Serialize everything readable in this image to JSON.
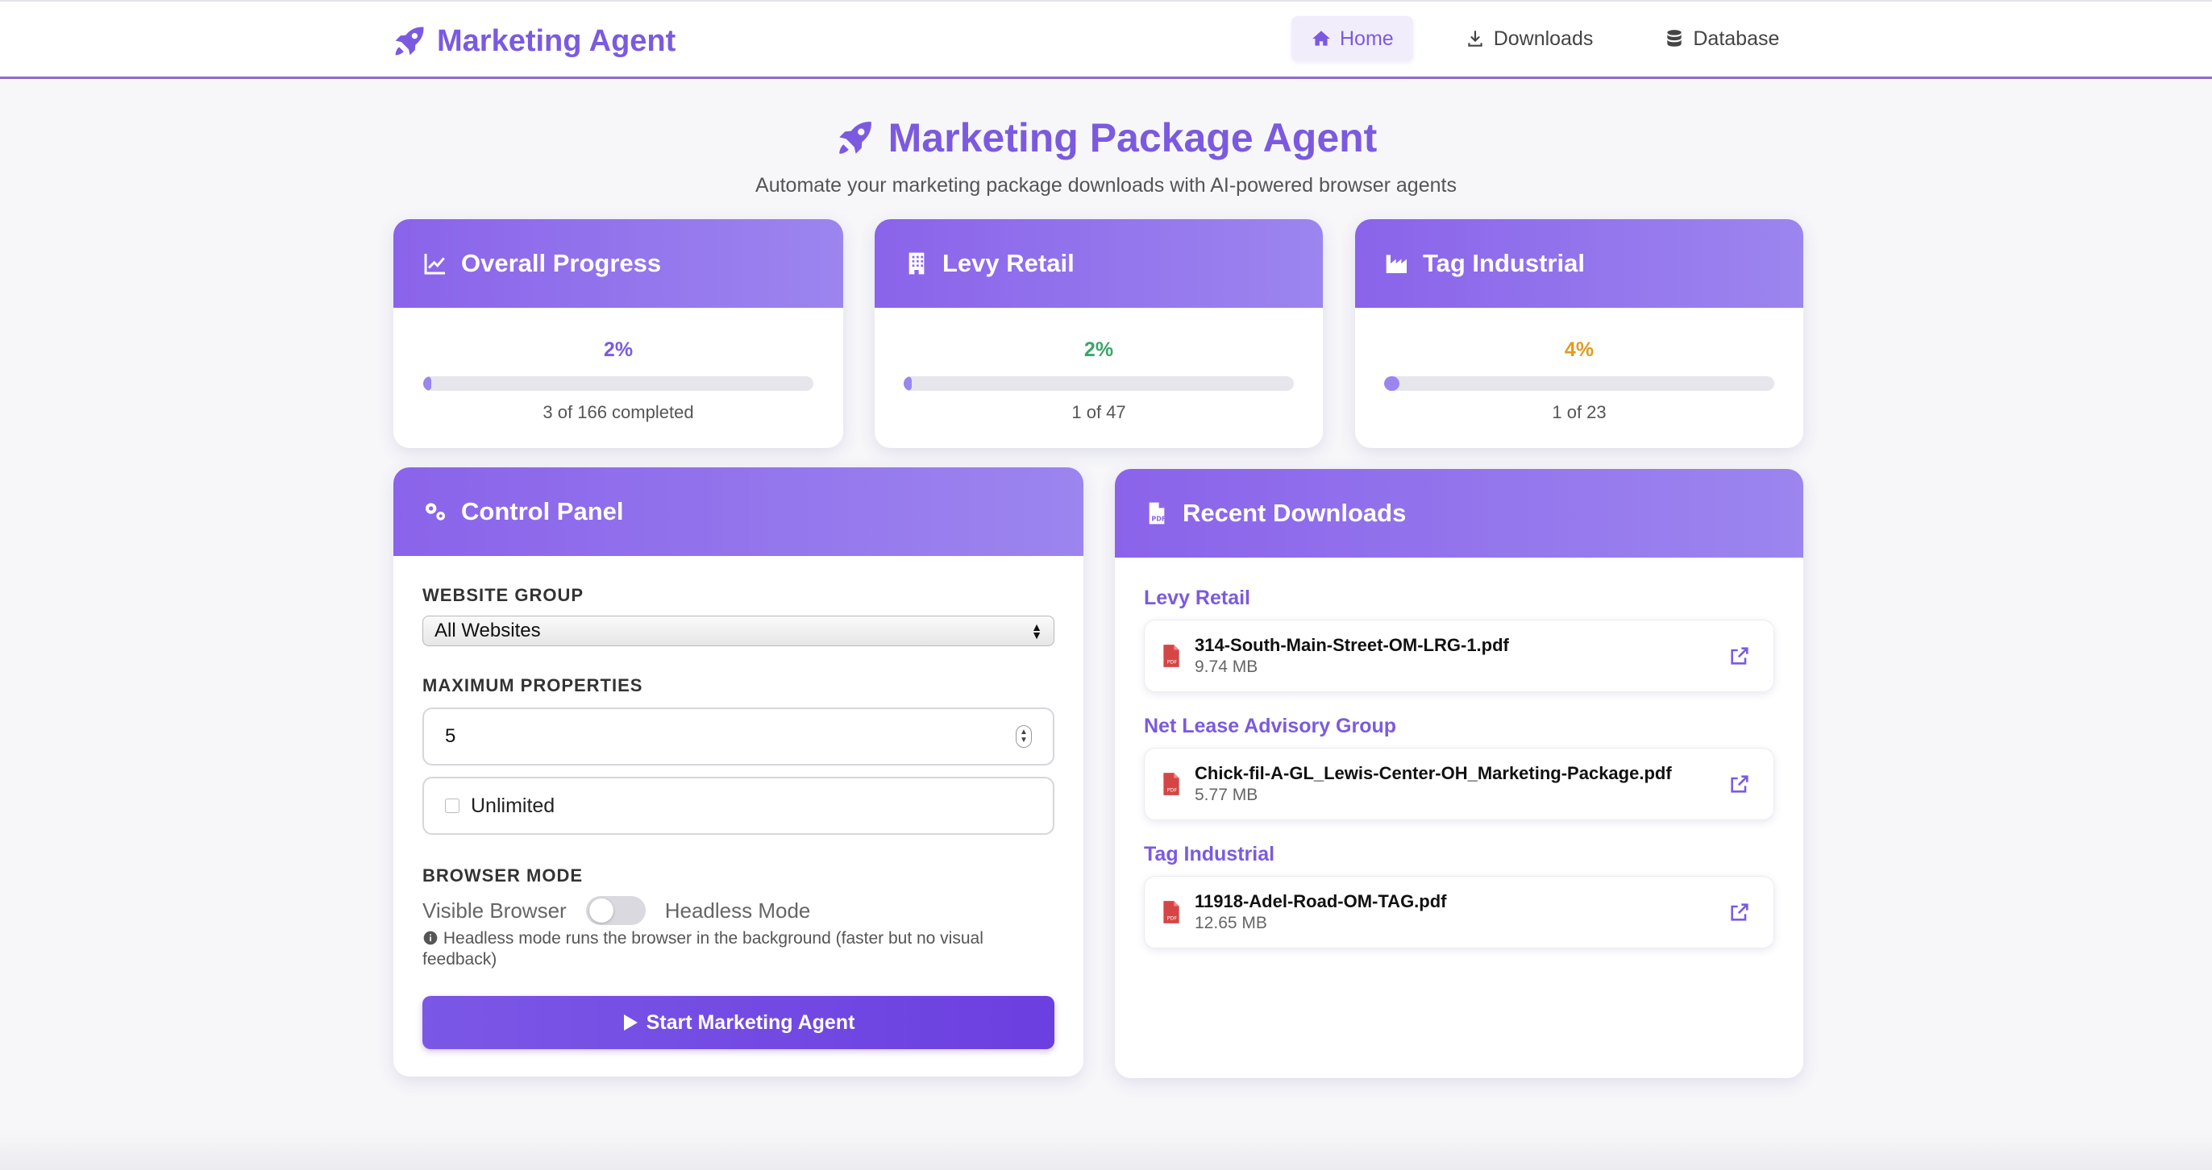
{
  "nav": {
    "brand": "Marketing Agent",
    "links": [
      {
        "label": "Home",
        "icon": "home-icon",
        "active": true
      },
      {
        "label": "Downloads",
        "icon": "download-icon",
        "active": false
      },
      {
        "label": "Database",
        "icon": "database-icon",
        "active": false
      }
    ]
  },
  "hero": {
    "title": "Marketing Package Agent",
    "subtitle": "Automate your marketing package downloads with AI-powered browser agents"
  },
  "stats": [
    {
      "title": "Overall Progress",
      "icon": "chart-line-icon",
      "percent": "2%",
      "progress_fraction": 0.02,
      "detail": "3 of 166 completed",
      "color": "#7b5ae0"
    },
    {
      "title": "Levy Retail",
      "icon": "building-icon",
      "percent": "2%",
      "progress_fraction": 0.02,
      "detail": "1 of 47",
      "color": "#3aa56b"
    },
    {
      "title": "Tag Industrial",
      "icon": "industry-icon",
      "percent": "4%",
      "progress_fraction": 0.04,
      "detail": "1 of 23",
      "color": "#e39a1e"
    }
  ],
  "control_panel": {
    "title": "Control Panel",
    "website_group_label": "WEBSITE GROUP",
    "website_group_value": "All Websites",
    "max_properties_label": "MAXIMUM PROPERTIES",
    "max_properties_value": "5",
    "unlimited_label": "Unlimited",
    "browser_mode_label": "BROWSER MODE",
    "visible_label": "Visible Browser",
    "headless_label": "Headless Mode",
    "headless_note": "Headless mode runs the browser in the background (faster but no visual feedback)",
    "start_button": "Start Marketing Agent"
  },
  "recent_downloads": {
    "title": "Recent Downloads",
    "groups": [
      {
        "name": "Levy Retail",
        "files": [
          {
            "name": "314-South-Main-Street-OM-LRG-1.pdf",
            "size": "9.74 MB"
          }
        ]
      },
      {
        "name": "Net Lease Advisory Group",
        "files": [
          {
            "name": "Chick-fil-A-GL_Lewis-Center-OH_Marketing-Package.pdf",
            "size": "5.77 MB"
          }
        ]
      },
      {
        "name": "Tag Industrial",
        "files": [
          {
            "name": "11918-Adel-Road-OM-TAG.pdf",
            "size": "12.65 MB"
          }
        ]
      }
    ]
  }
}
